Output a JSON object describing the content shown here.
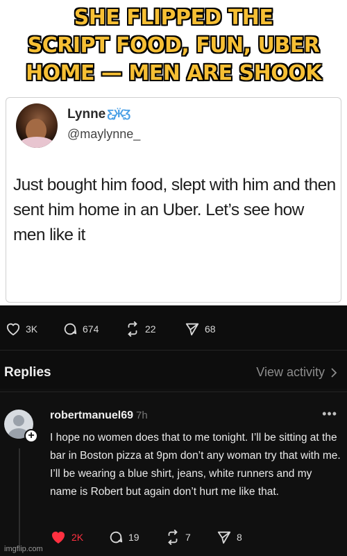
{
  "meme": {
    "caption_lines": [
      "SHE FLIPPED THE",
      "SCRIPT FOOD, FUN, UBER",
      "HOME — MEN ARE SHOOK"
    ]
  },
  "tweet": {
    "name": "Lynne",
    "handle": "@maylynne_",
    "text": "Just bought him food, slept with him and then sent him home in an Uber. Let’s see how men like it"
  },
  "post_stats": {
    "likes": "3K",
    "comments": "674",
    "reposts": "22",
    "shares": "68"
  },
  "replies_header": {
    "label": "Replies",
    "view_activity": "View activity"
  },
  "reply": {
    "username": "robertmanuel69",
    "time": "7h",
    "more_icon": "•••",
    "text": "I hope no women does that to me tonight. I’ll be sitting at the bar in Boston pizza at 9pm don’t any woman try that with me. I’ll be wearing a blue shirt, jeans, white runners and my name is Robert but again don’t hurt me like that.",
    "likes": "2K",
    "comments": "19",
    "reposts": "7",
    "shares": "8"
  },
  "colors": {
    "caption": "#f6bf34",
    "dark_bg": "#101010",
    "liked": "#ff3040"
  },
  "watermark": "imgflip.com"
}
